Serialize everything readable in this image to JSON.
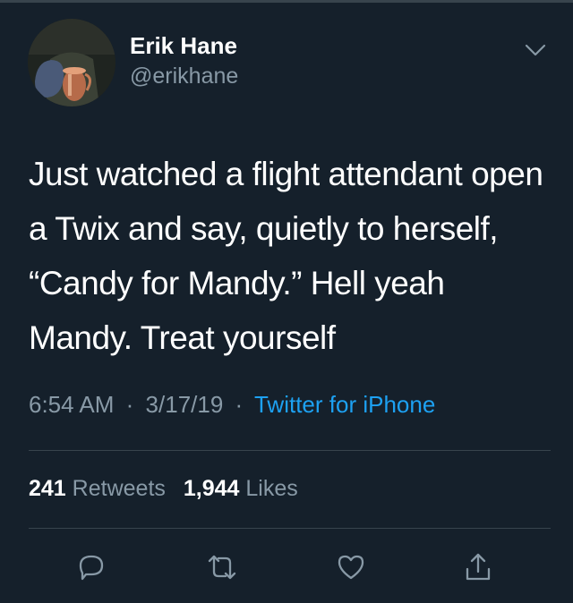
{
  "author": {
    "name": "Erik Hane",
    "handle": "@erikhane",
    "avatar": "avatar"
  },
  "menu_icon": "chevron-down-icon",
  "tweet": {
    "text": "Just watched a flight attendant open a Twix and say, quietly to herself, “Candy for Mandy.” Hell yeah Mandy. Treat yourself",
    "time": "6:54 AM",
    "date": "3/17/19",
    "separator": "·",
    "source": "Twitter for iPhone"
  },
  "stats": {
    "retweets_count": "241",
    "retweets_label": "Retweets",
    "likes_count": "1,944",
    "likes_label": "Likes"
  },
  "actions": [
    "reply-icon",
    "retweet-icon",
    "like-icon",
    "share-icon"
  ],
  "colors": {
    "background": "#15202b",
    "text": "#ffffff",
    "secondary_text": "#8899a6",
    "link": "#1da1f2",
    "divider": "#38444d"
  }
}
